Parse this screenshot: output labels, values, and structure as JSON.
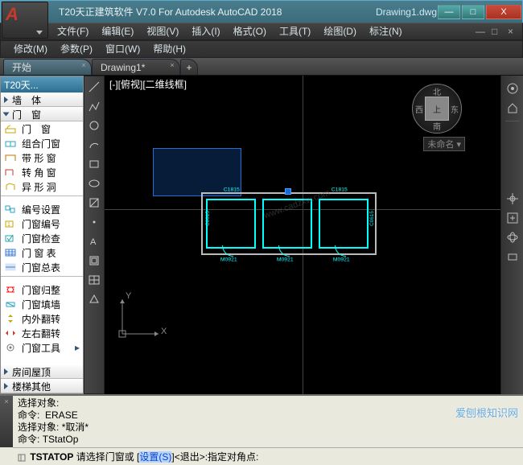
{
  "window": {
    "title": "T20天正建筑软件 V7.0 For Autodesk AutoCAD 2018",
    "file": "Drawing1.dwg",
    "min": "—",
    "max": "□",
    "close": "X"
  },
  "menus1": [
    "文件(F)",
    "编辑(E)",
    "视图(V)",
    "插入(I)",
    "格式(O)",
    "工具(T)",
    "绘图(D)",
    "标注(N)"
  ],
  "menus2": [
    "修改(M)",
    "参数(P)",
    "窗口(W)",
    "帮助(H)"
  ],
  "doc_tabs": {
    "start": "开始",
    "active": "Drawing1*",
    "add": "+"
  },
  "side": {
    "header": "T20天...",
    "top_items": [
      "墙　体",
      "门　窗"
    ],
    "items": [
      {
        "label": "门　窗",
        "color": "#caa400",
        "shape": "door"
      },
      {
        "label": "组合门窗",
        "color": "#2aa6c7",
        "shape": "combo"
      },
      {
        "label": "带 形 窗",
        "color": "#c07000",
        "shape": "band"
      },
      {
        "label": "转 角 窗",
        "color": "#c53a2b",
        "shape": "corner"
      },
      {
        "label": "异 形 洞",
        "color": "#caa400",
        "shape": "odd"
      }
    ],
    "items2": [
      {
        "label": "编号设置",
        "color": "#2aa6c7"
      },
      {
        "label": "门窗编号",
        "color": "#caa400"
      },
      {
        "label": "门窗检查",
        "color": "#2aa6c7"
      },
      {
        "label": "门 窗 表",
        "color": "#3b7bd6"
      },
      {
        "label": "门窗总表",
        "color": "#3b7bd6"
      }
    ],
    "items3": [
      {
        "label": "门窗归整",
        "color": "#ff0000"
      },
      {
        "label": "门窗填墙",
        "color": "#2aa6c7"
      },
      {
        "label": "内外翻转",
        "color": "#caa400"
      },
      {
        "label": "左右翻转",
        "color": "#c53a2b"
      },
      {
        "label": "门窗工具",
        "color": "#777"
      }
    ],
    "bottom_items": [
      "房间屋顶",
      "楼梯其他"
    ]
  },
  "viewport": {
    "label": "[-][俯视][二维线框]",
    "named": "未命名 ▾",
    "compass_center": "上",
    "compass_n": "北",
    "compass_s": "南",
    "compass_w": "西",
    "compass_e": "东",
    "axis_x": "X",
    "axis_y": "Y"
  },
  "plan_labels": {
    "top1": "C1815",
    "top2": "C1815",
    "left": "C0615",
    "mid": "C0615",
    "d1": "M0921",
    "d2": "M0921",
    "d3": "M0921"
  },
  "cmd": {
    "l1": "选择对象:",
    "l2a": "命令:",
    "l2b": "ERASE",
    "l3a": "选择对象:",
    "l3b": "*取消*",
    "l4a": "命令:",
    "l4b": "TStatOp",
    "prompt_k": "TSTATOP",
    "prompt_t": "请选择门窗或 [",
    "prompt_opt": "设置(S)",
    "prompt_tail": "]<退出>:指定对角点:"
  },
  "watermark": "爱刨根知识网"
}
